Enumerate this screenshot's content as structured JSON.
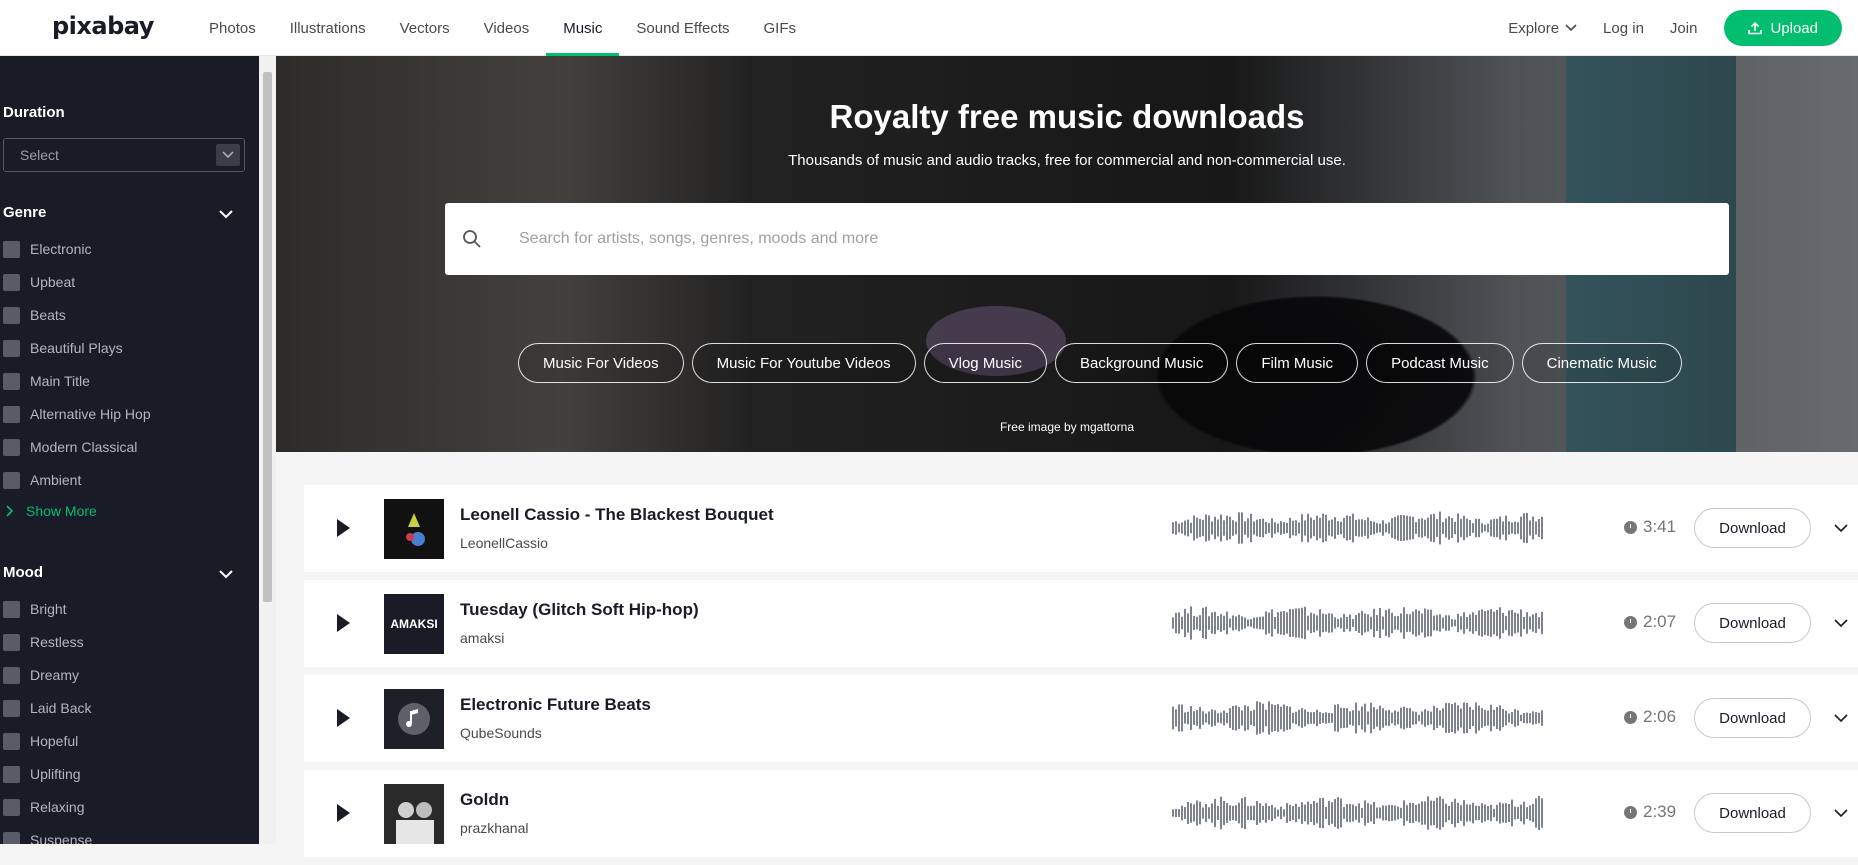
{
  "brand": {
    "logo": "pixabay",
    "accent": "#02be6e"
  },
  "nav": {
    "items": [
      "Photos",
      "Illustrations",
      "Vectors",
      "Videos",
      "Music",
      "Sound Effects",
      "GIFs"
    ],
    "active": "Music",
    "explore": "Explore",
    "login": "Log in",
    "join": "Join",
    "upload": "Upload"
  },
  "sidebar": {
    "duration_title": "Duration",
    "duration_select": "Select",
    "genre_title": "Genre",
    "genres": [
      "Electronic",
      "Upbeat",
      "Beats",
      "Beautiful Plays",
      "Main Title",
      "Alternative Hip Hop",
      "Modern Classical",
      "Ambient"
    ],
    "show_more": "Show More",
    "mood_title": "Mood",
    "moods": [
      "Bright",
      "Restless",
      "Dreamy",
      "Laid Back",
      "Hopeful",
      "Uplifting",
      "Relaxing",
      "Suspense"
    ]
  },
  "hero": {
    "title": "Royalty free music downloads",
    "subtitle": "Thousands of music and audio tracks, free for commercial and non-commercial use.",
    "search_placeholder": "Search for artists, songs, genres, moods and more",
    "chips": [
      "Music For Videos",
      "Music For Youtube Videos",
      "Vlog Music",
      "Background Music",
      "Film Music",
      "Podcast Music",
      "Cinematic Music"
    ],
    "credit": "Free image by mgattorna"
  },
  "tracks": [
    {
      "title": "Leonell Cassio - The Blackest Bouquet",
      "artist": "LeonellCassio",
      "duration": "3:41",
      "download": "Download"
    },
    {
      "title": "Tuesday (Glitch Soft Hip-hop)",
      "artist": "amaksi",
      "duration": "2:07",
      "download": "Download",
      "thumb_text": "AMAKSI"
    },
    {
      "title": "Electronic Future Beats",
      "artist": "QubeSounds",
      "duration": "2:06",
      "download": "Download"
    },
    {
      "title": "Goldn",
      "artist": "prazkhanal",
      "duration": "2:39",
      "download": "Download"
    }
  ]
}
